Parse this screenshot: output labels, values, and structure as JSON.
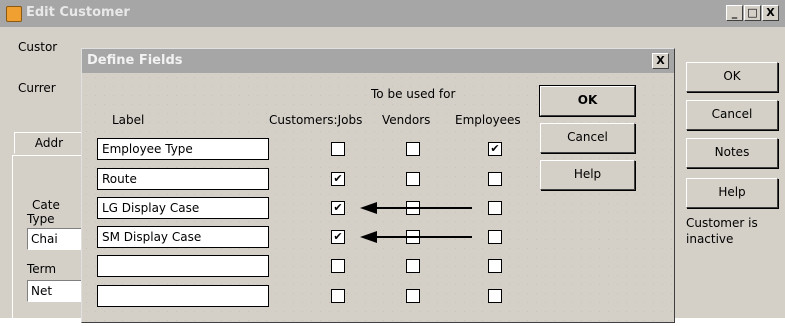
{
  "edit_window": {
    "title": "Edit Customer",
    "controls": {
      "minimize": "_",
      "maximize": "□",
      "close": "X"
    },
    "labels": {
      "customer": "Custor",
      "currency": "Currer"
    },
    "tab_label": "Addr",
    "group": {
      "category": "Cate",
      "type": "Type",
      "type_value": "Chai",
      "terms": "Term",
      "terms_value": "Net"
    },
    "buttons": {
      "ok": "OK",
      "cancel": "Cancel",
      "notes": "Notes",
      "help": "Help"
    },
    "inactive_text_1": "Customer is",
    "inactive_text_2": "inactive"
  },
  "dialog": {
    "title": "Define Fields",
    "close": "X",
    "headers": {
      "label": "Label",
      "used_for": "To be used for",
      "customers": "Customers:Jobs",
      "vendors": "Vendors",
      "employees": "Employees"
    },
    "rows": [
      {
        "label": "Employee Type",
        "customers": "",
        "vendors": "",
        "employees": "✔"
      },
      {
        "label": "Route",
        "customers": "✔",
        "vendors": "",
        "employees": ""
      },
      {
        "label": "LG Display Case",
        "customers": "✔",
        "vendors": "",
        "employees": ""
      },
      {
        "label": "SM Display Case",
        "customers": "✔",
        "vendors": "",
        "employees": ""
      },
      {
        "label": "",
        "customers": "",
        "vendors": "",
        "employees": ""
      },
      {
        "label": "",
        "customers": "",
        "vendors": "",
        "employees": ""
      }
    ],
    "buttons": {
      "ok": "OK",
      "cancel": "Cancel",
      "help": "Help"
    }
  },
  "colors": {
    "titlebar_inactive": "#a6a6a6",
    "dialog_bg": "#d4d0c8",
    "arrow": "#000000"
  }
}
